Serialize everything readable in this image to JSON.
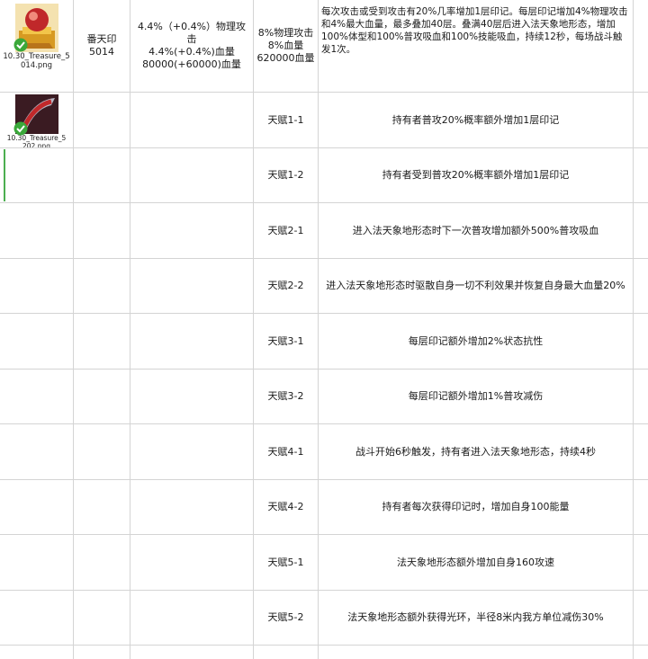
{
  "rows": [
    {
      "image_file": "10.30_Treasure_5014.png",
      "name": "番天印",
      "id": "5014",
      "attr": [
        "4.4%（+0.4%）物理攻击",
        "4.4%(+0.4%)血量",
        "80000(+60000)血量"
      ],
      "base": [
        "8%物理攻击",
        "8%血量",
        "620000血量"
      ],
      "desc": "每次攻击或受到攻击有20%几率增加1层印记。每层印记增加4%物理攻击和4%最大血量，最多叠加40层。叠满40层后进入法天象地形态，增加100%体型和100%普攻吸血和100%技能吸血，持续12秒，每场战斗触发1次。"
    },
    {
      "image_file": "10.30_Treasure_5202.png",
      "talent": "天赋1-1",
      "desc": "持有者普攻20%概率额外增加1层印记"
    },
    {
      "talent": "天赋1-2",
      "desc": "持有者受到普攻20%概率额外增加1层印记"
    },
    {
      "talent": "天赋2-1",
      "desc": "进入法天象地形态时下一次普攻增加额外500%普攻吸血"
    },
    {
      "talent": "天赋2-2",
      "desc": "进入法天象地形态时驱散自身一切不利效果并恢复自身最大血量20%"
    },
    {
      "talent": "天赋3-1",
      "desc": "每层印记额外增加2%状态抗性"
    },
    {
      "talent": "天赋3-2",
      "desc": "每层印记额外增加1%普攻减伤"
    },
    {
      "talent": "天赋4-1",
      "desc": "战斗开始6秒触发，持有者进入法天象地形态，持续4秒"
    },
    {
      "talent": "天赋4-2",
      "desc": "持有者每次获得印记时，增加自身100能量"
    },
    {
      "talent": "天赋5-1",
      "desc": "法天象地形态额外增加自身160攻速"
    },
    {
      "talent": "天赋5-2",
      "desc": "法天象地形态额外获得光环，半径8米内我方单位减伤30%"
    }
  ],
  "colors": {
    "grid": "#d4d4d4",
    "check_green": "#3aa83a",
    "treasure_red": "#c0282a",
    "treasure_gold": "#e3a526"
  },
  "icons": [
    "treasure-5014-thumbnail",
    "treasure-5202-thumbnail",
    "checkmark-icon"
  ]
}
